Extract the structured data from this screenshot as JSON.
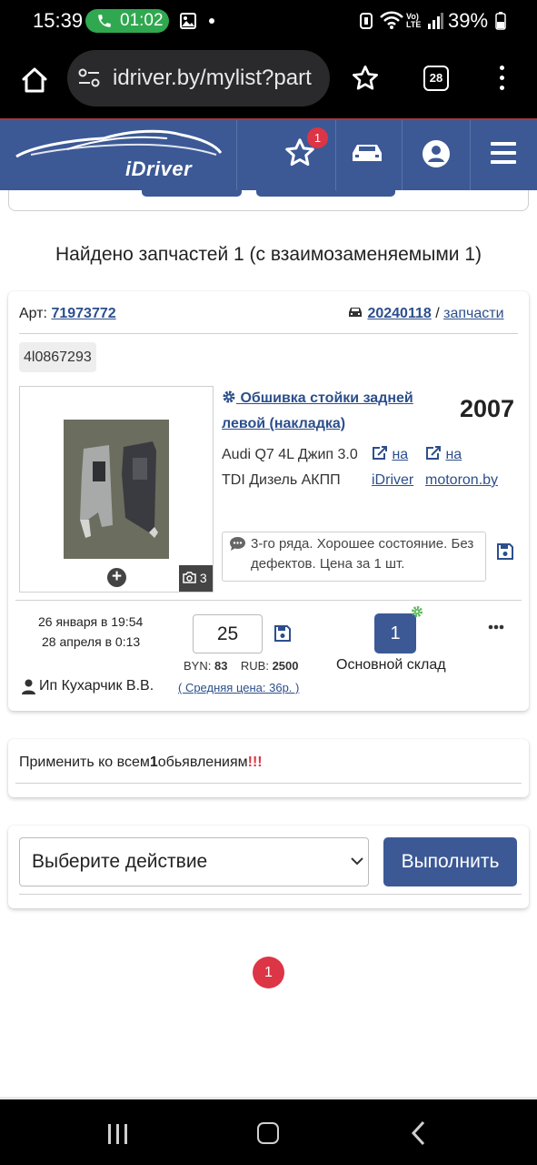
{
  "status_bar": {
    "time": "15:39",
    "call_timer": "01:02",
    "volte": "Vo) LTE",
    "battery": "39%"
  },
  "browser": {
    "url": "idriver.by/mylist?part",
    "tab_count": "28"
  },
  "header": {
    "logo_text": "iDriver",
    "favorites_count": "1",
    "accent_color": "#3c5996",
    "badge_color": "#dc3545"
  },
  "results": {
    "found_title": "Найдено запчастей 1 (с взаимозаменяемыми 1)"
  },
  "part": {
    "art_label": "Арт:",
    "art_number": "71973772",
    "date_code": "20240118",
    "separator": "/",
    "spare_link": "запчасти",
    "oem": "4l0867293",
    "title": "Обшивка стойки задней левой (накладка)",
    "year": "2007",
    "car_description": "Audi Q7 4L Джип 3.0 TDI Дизель АКПП",
    "link_idriver_prefix": "на",
    "link_idriver": "iDriver",
    "link_motoron_prefix": "на",
    "link_motoron": "motoron.by",
    "photo_count": "3",
    "comment": "3-го ряда. Хорошее состояние. Без дефектов. Цена за 1 шт.",
    "created": "26 января в 19:54",
    "updated": "28 апреля в 0:13",
    "seller": "Ип Кухарчик В.В.",
    "price": "25",
    "byn_label": "BYN:",
    "byn_value": "83",
    "rub_label": "RUB:",
    "rub_value": "2500",
    "avg_price": "( Средняя цена: 36р. )",
    "stock_count": "1",
    "stock_label": "Основной склад"
  },
  "apply": {
    "prefix": "Применить ко всем",
    "count": "1",
    "suffix": "обьявлениям",
    "exclaim": "!!!"
  },
  "actions": {
    "select_value": "Выберите действие",
    "run_label": "Выполнить"
  },
  "pagination": {
    "current_page": "1"
  }
}
